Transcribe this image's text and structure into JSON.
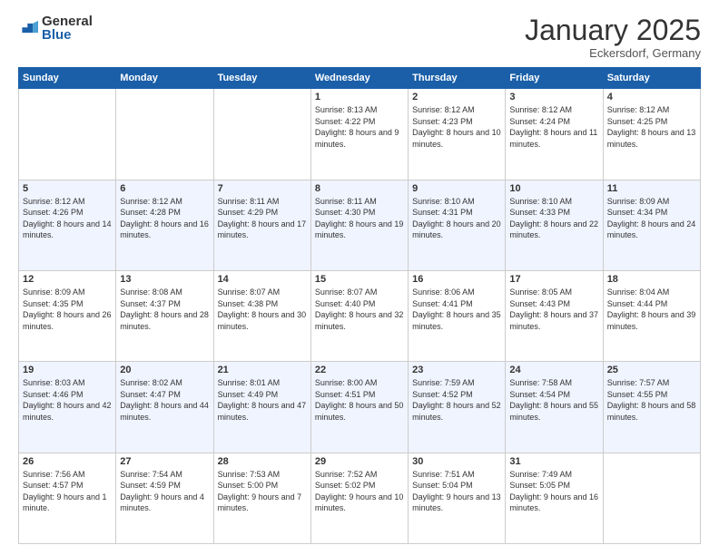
{
  "logo": {
    "general": "General",
    "blue": "Blue"
  },
  "header": {
    "month": "January 2025",
    "location": "Eckersdorf, Germany"
  },
  "days": [
    "Sunday",
    "Monday",
    "Tuesday",
    "Wednesday",
    "Thursday",
    "Friday",
    "Saturday"
  ],
  "weeks": [
    [
      {
        "day": "",
        "sunrise": "",
        "sunset": "",
        "daylight": ""
      },
      {
        "day": "",
        "sunrise": "",
        "sunset": "",
        "daylight": ""
      },
      {
        "day": "",
        "sunrise": "",
        "sunset": "",
        "daylight": ""
      },
      {
        "day": "1",
        "sunrise": "Sunrise: 8:13 AM",
        "sunset": "Sunset: 4:22 PM",
        "daylight": "Daylight: 8 hours and 9 minutes."
      },
      {
        "day": "2",
        "sunrise": "Sunrise: 8:12 AM",
        "sunset": "Sunset: 4:23 PM",
        "daylight": "Daylight: 8 hours and 10 minutes."
      },
      {
        "day": "3",
        "sunrise": "Sunrise: 8:12 AM",
        "sunset": "Sunset: 4:24 PM",
        "daylight": "Daylight: 8 hours and 11 minutes."
      },
      {
        "day": "4",
        "sunrise": "Sunrise: 8:12 AM",
        "sunset": "Sunset: 4:25 PM",
        "daylight": "Daylight: 8 hours and 13 minutes."
      }
    ],
    [
      {
        "day": "5",
        "sunrise": "Sunrise: 8:12 AM",
        "sunset": "Sunset: 4:26 PM",
        "daylight": "Daylight: 8 hours and 14 minutes."
      },
      {
        "day": "6",
        "sunrise": "Sunrise: 8:12 AM",
        "sunset": "Sunset: 4:28 PM",
        "daylight": "Daylight: 8 hours and 16 minutes."
      },
      {
        "day": "7",
        "sunrise": "Sunrise: 8:11 AM",
        "sunset": "Sunset: 4:29 PM",
        "daylight": "Daylight: 8 hours and 17 minutes."
      },
      {
        "day": "8",
        "sunrise": "Sunrise: 8:11 AM",
        "sunset": "Sunset: 4:30 PM",
        "daylight": "Daylight: 8 hours and 19 minutes."
      },
      {
        "day": "9",
        "sunrise": "Sunrise: 8:10 AM",
        "sunset": "Sunset: 4:31 PM",
        "daylight": "Daylight: 8 hours and 20 minutes."
      },
      {
        "day": "10",
        "sunrise": "Sunrise: 8:10 AM",
        "sunset": "Sunset: 4:33 PM",
        "daylight": "Daylight: 8 hours and 22 minutes."
      },
      {
        "day": "11",
        "sunrise": "Sunrise: 8:09 AM",
        "sunset": "Sunset: 4:34 PM",
        "daylight": "Daylight: 8 hours and 24 minutes."
      }
    ],
    [
      {
        "day": "12",
        "sunrise": "Sunrise: 8:09 AM",
        "sunset": "Sunset: 4:35 PM",
        "daylight": "Daylight: 8 hours and 26 minutes."
      },
      {
        "day": "13",
        "sunrise": "Sunrise: 8:08 AM",
        "sunset": "Sunset: 4:37 PM",
        "daylight": "Daylight: 8 hours and 28 minutes."
      },
      {
        "day": "14",
        "sunrise": "Sunrise: 8:07 AM",
        "sunset": "Sunset: 4:38 PM",
        "daylight": "Daylight: 8 hours and 30 minutes."
      },
      {
        "day": "15",
        "sunrise": "Sunrise: 8:07 AM",
        "sunset": "Sunset: 4:40 PM",
        "daylight": "Daylight: 8 hours and 32 minutes."
      },
      {
        "day": "16",
        "sunrise": "Sunrise: 8:06 AM",
        "sunset": "Sunset: 4:41 PM",
        "daylight": "Daylight: 8 hours and 35 minutes."
      },
      {
        "day": "17",
        "sunrise": "Sunrise: 8:05 AM",
        "sunset": "Sunset: 4:43 PM",
        "daylight": "Daylight: 8 hours and 37 minutes."
      },
      {
        "day": "18",
        "sunrise": "Sunrise: 8:04 AM",
        "sunset": "Sunset: 4:44 PM",
        "daylight": "Daylight: 8 hours and 39 minutes."
      }
    ],
    [
      {
        "day": "19",
        "sunrise": "Sunrise: 8:03 AM",
        "sunset": "Sunset: 4:46 PM",
        "daylight": "Daylight: 8 hours and 42 minutes."
      },
      {
        "day": "20",
        "sunrise": "Sunrise: 8:02 AM",
        "sunset": "Sunset: 4:47 PM",
        "daylight": "Daylight: 8 hours and 44 minutes."
      },
      {
        "day": "21",
        "sunrise": "Sunrise: 8:01 AM",
        "sunset": "Sunset: 4:49 PM",
        "daylight": "Daylight: 8 hours and 47 minutes."
      },
      {
        "day": "22",
        "sunrise": "Sunrise: 8:00 AM",
        "sunset": "Sunset: 4:51 PM",
        "daylight": "Daylight: 8 hours and 50 minutes."
      },
      {
        "day": "23",
        "sunrise": "Sunrise: 7:59 AM",
        "sunset": "Sunset: 4:52 PM",
        "daylight": "Daylight: 8 hours and 52 minutes."
      },
      {
        "day": "24",
        "sunrise": "Sunrise: 7:58 AM",
        "sunset": "Sunset: 4:54 PM",
        "daylight": "Daylight: 8 hours and 55 minutes."
      },
      {
        "day": "25",
        "sunrise": "Sunrise: 7:57 AM",
        "sunset": "Sunset: 4:55 PM",
        "daylight": "Daylight: 8 hours and 58 minutes."
      }
    ],
    [
      {
        "day": "26",
        "sunrise": "Sunrise: 7:56 AM",
        "sunset": "Sunset: 4:57 PM",
        "daylight": "Daylight: 9 hours and 1 minute."
      },
      {
        "day": "27",
        "sunrise": "Sunrise: 7:54 AM",
        "sunset": "Sunset: 4:59 PM",
        "daylight": "Daylight: 9 hours and 4 minutes."
      },
      {
        "day": "28",
        "sunrise": "Sunrise: 7:53 AM",
        "sunset": "Sunset: 5:00 PM",
        "daylight": "Daylight: 9 hours and 7 minutes."
      },
      {
        "day": "29",
        "sunrise": "Sunrise: 7:52 AM",
        "sunset": "Sunset: 5:02 PM",
        "daylight": "Daylight: 9 hours and 10 minutes."
      },
      {
        "day": "30",
        "sunrise": "Sunrise: 7:51 AM",
        "sunset": "Sunset: 5:04 PM",
        "daylight": "Daylight: 9 hours and 13 minutes."
      },
      {
        "day": "31",
        "sunrise": "Sunrise: 7:49 AM",
        "sunset": "Sunset: 5:05 PM",
        "daylight": "Daylight: 9 hours and 16 minutes."
      },
      {
        "day": "",
        "sunrise": "",
        "sunset": "",
        "daylight": ""
      }
    ]
  ]
}
